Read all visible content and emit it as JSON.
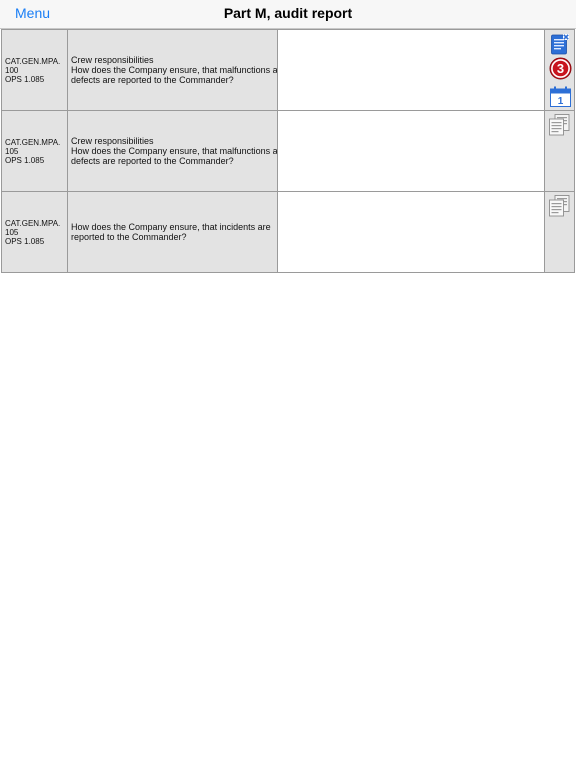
{
  "navbar": {
    "menu_label": "Menu",
    "title": "Part M, audit report"
  },
  "rows": [
    {
      "code": "CAT.GEN.MPA.\n100\nOPS 1.085",
      "question": "Crew responsibilities\nHow does the Company ensure, that malfunctions a\ndefects are reported to the Commander?",
      "answer": "",
      "icons": [
        "document-remove-icon",
        "badge-count-icon",
        "calendar-icon"
      ],
      "badge_count": "3",
      "calendar_day": "1"
    },
    {
      "code": "CAT.GEN.MPA.\n105\nOPS 1.085",
      "question": "Crew responsibilities\nHow does the Company ensure, that malfunctions a\ndefects are reported to the Commander?",
      "answer": "",
      "icons": [
        "copy-documents-icon"
      ]
    },
    {
      "code": "CAT.GEN.MPA.\n105\nOPS 1.085",
      "question": "How does the Company ensure, that incidents are\nreported to the Commander?",
      "answer": "",
      "icons": [
        "copy-documents-icon"
      ]
    }
  ],
  "colors": {
    "accent": "#1a7ef5",
    "badge": "#c8141e",
    "cell_gray": "#e3e3e3",
    "border": "#9a9a9a"
  }
}
